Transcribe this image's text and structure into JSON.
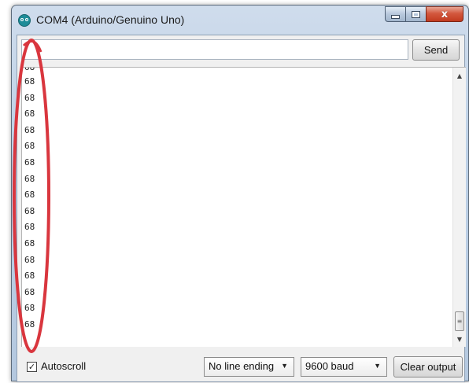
{
  "window": {
    "title": "COM4 (Arduino/Genuino Uno)",
    "controls": {
      "minimize_icon": "minimize-icon",
      "maximize_icon": "maximize-icon",
      "close_icon": "close-icon",
      "close_glyph": "x"
    }
  },
  "input": {
    "value": "",
    "send_label": "Send"
  },
  "output": {
    "lines": [
      "68",
      "68",
      "68",
      "68",
      "68",
      "68",
      "68",
      "68",
      "68",
      "68",
      "68",
      "68",
      "68",
      "68",
      "68",
      "68"
    ],
    "partial_top_line": "68"
  },
  "footer": {
    "autoscroll_label": "Autoscroll",
    "autoscroll_checked": true,
    "line_ending": "No line ending",
    "baud_rate": "9600 baud",
    "clear_label": "Clear output"
  },
  "annotation": {
    "shape": "ellipse",
    "color": "#d9363e"
  },
  "colors": {
    "title_bar": "#bcd0e6",
    "close_button": "#c23a1f",
    "app_icon": "#1e8c98"
  }
}
